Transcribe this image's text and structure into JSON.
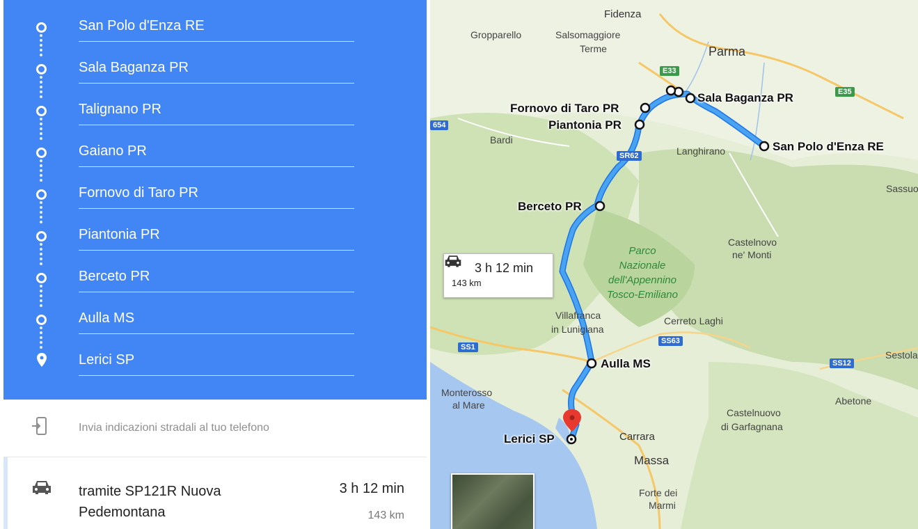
{
  "waypoints": [
    {
      "label": "San Polo d'Enza RE",
      "type": "stop"
    },
    {
      "label": "Sala Baganza PR",
      "type": "stop"
    },
    {
      "label": "Talignano PR",
      "type": "stop"
    },
    {
      "label": "Gaiano PR",
      "type": "stop"
    },
    {
      "label": "Fornovo di Taro PR",
      "type": "stop"
    },
    {
      "label": "Piantonia PR",
      "type": "stop"
    },
    {
      "label": "Berceto PR",
      "type": "stop"
    },
    {
      "label": "Aulla MS",
      "type": "stop"
    },
    {
      "label": "Lerici SP",
      "type": "destination"
    }
  ],
  "send_to_phone": {
    "label": "Invia indicazioni stradali al tuo telefono",
    "icon": "send-to-phone-icon"
  },
  "route": {
    "via": "tramite SP121R Nuova Pedemontana",
    "time": "3 h 12 min",
    "distance": "143 km",
    "icon": "car-icon"
  },
  "map": {
    "towns": {
      "fidenza": "Fidenza",
      "gropparello": "Gropparello",
      "salsomaggiore": "Salsomaggiore",
      "terme": "Terme",
      "parma": "Parma",
      "bardi": "Bardi",
      "langhirano": "Langhirano",
      "sassuolo": "Sassuo",
      "castelnovo": "Castelnovo",
      "ne_monti": "ne' Monti",
      "villafranca": "Villafranca",
      "in_lunigiana": "in Lunigiana",
      "cerreto": "Cerreto Laghi",
      "sestola": "Sestola",
      "monterosso": "Monterosso",
      "al_mare": "al Mare",
      "abetone": "Abetone",
      "castelnuovo": "Castelnuovo",
      "di_garfagnana": "di Garfagnana",
      "carrara": "Carrara",
      "massa": "Massa",
      "forte": "Forte dei",
      "marmi": "Marmi"
    },
    "park": [
      "Parco",
      "Nazionale",
      "dell'Appennino",
      "Tosco-Emiliano"
    ],
    "roads": {
      "e33": "E33",
      "e35": "E35",
      "sr62": "SR62",
      "ss1": "SS1",
      "ss63": "SS63",
      "ss12": "SS12",
      "r654": "654"
    },
    "waypoint_labels": {
      "sala_baganza": "Sala Baganza PR",
      "san_polo": "San Polo d'Enza RE",
      "fornovo": "Fornovo di Taro PR",
      "piantonia": "Piantonia PR",
      "berceto": "Berceto PR",
      "aulla": "Aulla MS",
      "lerici": "Lerici SP"
    },
    "time_box": {
      "time": "3 h 12 min",
      "distance": "143 km"
    },
    "colors": {
      "route": "#4aa3f0",
      "route_outline": "#1a73e8",
      "sea": "#a5c7f0",
      "land": "#e7eed8",
      "forest": "#c5dcaa",
      "destination_pin": "#e8392f"
    }
  }
}
